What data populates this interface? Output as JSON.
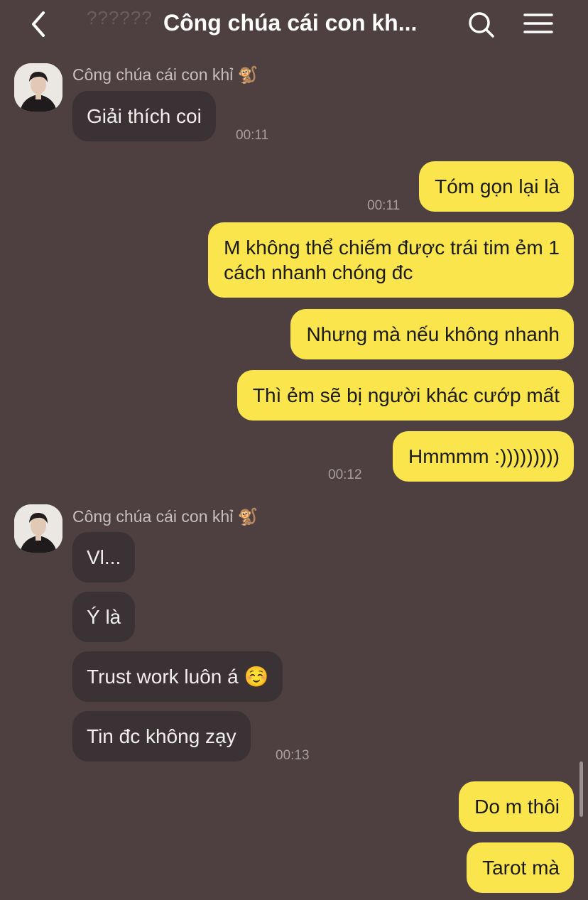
{
  "header": {
    "title": "Công chúa cái con kh...",
    "prev_preview": "??????",
    "back_icon": "chevron-left-icon",
    "search_icon": "search-icon",
    "menu_icon": "hamburger-menu-icon"
  },
  "colors": {
    "background": "#4e3f40",
    "incoming_bubble": "#3a3234",
    "outgoing_bubble": "#fae54d"
  },
  "sender_name": "Công chúa cái con khỉ 🐒",
  "messages": {
    "m1": {
      "text": "Giải thích coi",
      "time": "00:11"
    },
    "m2": {
      "text": "Tóm gọn lại là",
      "time": "00:11"
    },
    "m3": {
      "line1": "M không thể chiếm được trái tim ẻm 1",
      "line2": "cách nhanh chóng đc"
    },
    "m4": {
      "text": "Nhưng mà nếu không nhanh"
    },
    "m5": {
      "text": "Thì ẻm sẽ bị người khác cướp mất"
    },
    "m6": {
      "text": "Hmmmm :)))))))))",
      "time": "00:12"
    },
    "m7": {
      "text": "Vl..."
    },
    "m8": {
      "text": "Ý là"
    },
    "m9": {
      "text": "Trust work luôn á ☺️"
    },
    "m10": {
      "text": "Tin đc không zạy",
      "time": "00:13"
    },
    "m11": {
      "text": "Do m thôi"
    },
    "m12": {
      "text": "Tarot mà"
    }
  }
}
